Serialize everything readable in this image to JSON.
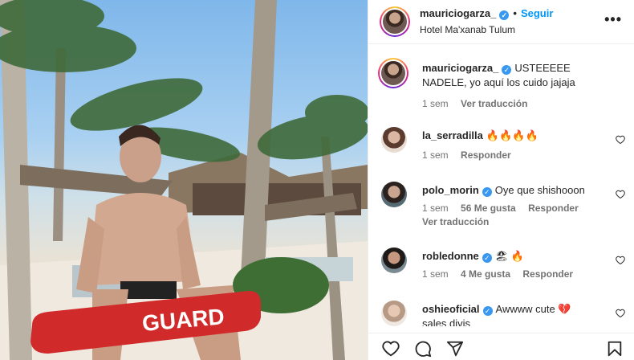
{
  "header": {
    "username": "mauriciogarza_",
    "follow_label": "Seguir",
    "location": "Hotel Ma'xanab Tulum",
    "verified_mark": "✓",
    "dot": "•"
  },
  "photo": {
    "sign_text": "GUARD"
  },
  "caption": {
    "username": "mauriciogarza_",
    "text": "USTEEEEE NADELE, yo aquí los cuido jajaja",
    "time": "1 sem",
    "translate": "Ver traducción"
  },
  "comments": [
    {
      "username": "la_serradilla",
      "text": "🔥🔥🔥🔥",
      "time": "1 sem",
      "likes": "",
      "reply": "Responder",
      "translate": ""
    },
    {
      "username": "polo_morin",
      "text": "Oye que shishooon",
      "time": "1 sem",
      "likes": "56 Me gusta",
      "reply": "Responder",
      "translate": "Ver traducción"
    },
    {
      "username": "robledonne",
      "text": "🏖 🔥",
      "time": "1 sem",
      "likes": "4 Me gusta",
      "reply": "Responder",
      "translate": ""
    },
    {
      "username": "oshieoficial",
      "text": "Awwww cute 💔",
      "time": "",
      "likes": "",
      "reply": "",
      "translate": "",
      "overflow": "sales divis"
    }
  ],
  "icons": {
    "more": "more-options-icon",
    "like": "heart-icon",
    "comment": "comment-icon",
    "share": "share-icon",
    "save": "bookmark-icon"
  },
  "colors": {
    "accent": "#0095f6",
    "verified": "#3897f0",
    "meta": "#737373"
  }
}
